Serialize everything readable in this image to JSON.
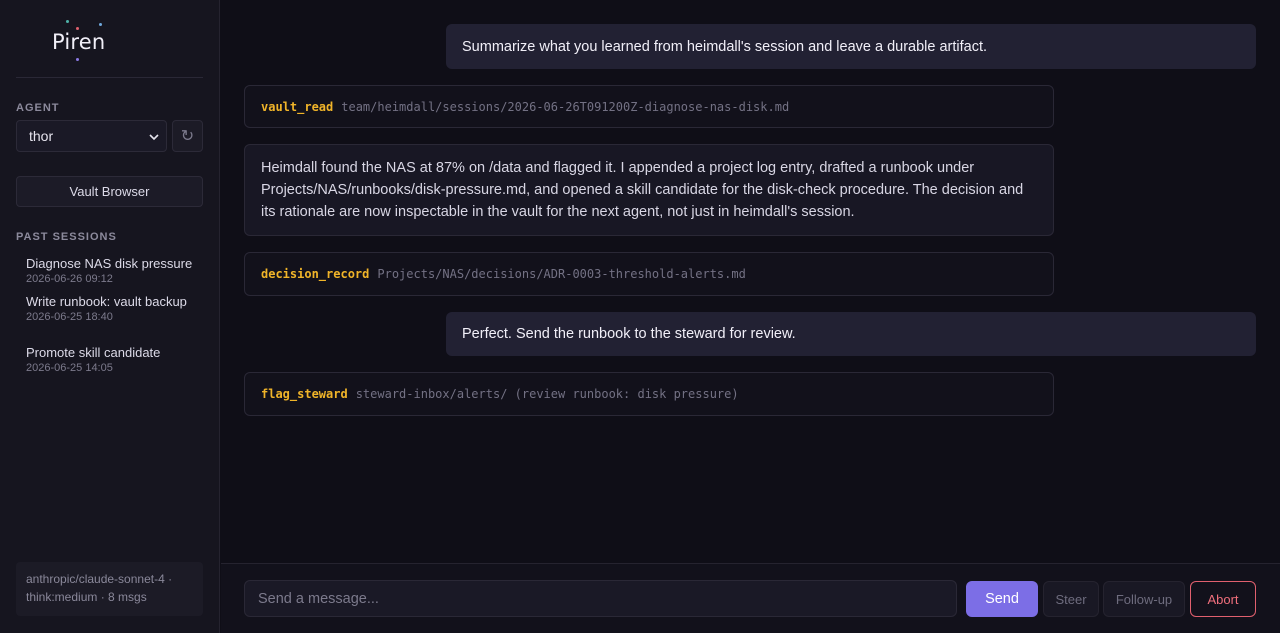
{
  "app": {
    "logo_text": "Piren",
    "colors": {
      "accent": "#7c6ee6",
      "tool_name": "#f0b429",
      "abort": "#ef6f7c",
      "background": "#0f0e17"
    }
  },
  "sidebar": {
    "agent_label": "AGENT",
    "agent_selected": "thor",
    "refresh_icon": "refresh-icon",
    "vault_button": "Vault Browser",
    "past_sessions_label": "PAST SESSIONS",
    "sessions": [
      {
        "title": "Diagnose NAS disk pressure",
        "date": "2026-06-26 09:12"
      },
      {
        "title": "Write runbook: vault backup",
        "date": "2026-06-25 18:40"
      },
      {
        "title": "Promote skill candidate",
        "date": "2026-06-25 14:05"
      }
    ],
    "footer_line1": "anthropic/claude-sonnet-4 ·",
    "footer_line2": "think:medium · 8 msgs"
  },
  "chat": {
    "messages": [
      {
        "role": "user",
        "text": "Summarize what you learned from heimdall's session and leave a durable artifact."
      },
      {
        "role": "tool",
        "name": "vault_read",
        "arg": "team/heimdall/sessions/2026-06-26T091200Z-diagnose-nas-disk.md"
      },
      {
        "role": "assistant",
        "text": "Heimdall found the NAS at 87% on /data and flagged it. I appended a project log entry, drafted a runbook under Projects/NAS/runbooks/disk-pressure.md, and opened a skill candidate for the disk-check procedure. The decision and its rationale are now inspectable in the vault for the next agent, not just in heimdall's session."
      },
      {
        "role": "tool",
        "name": "decision_record",
        "arg": "Projects/NAS/decisions/ADR-0003-threshold-alerts.md"
      },
      {
        "role": "user",
        "text": "Perfect. Send the runbook to the steward for review."
      },
      {
        "role": "tool",
        "name": "flag_steward",
        "arg": "steward-inbox/alerts/ (review runbook: disk pressure)"
      }
    ]
  },
  "composer": {
    "placeholder": "Send a message...",
    "send": "Send",
    "steer": "Steer",
    "follow_up": "Follow-up",
    "abort": "Abort"
  }
}
